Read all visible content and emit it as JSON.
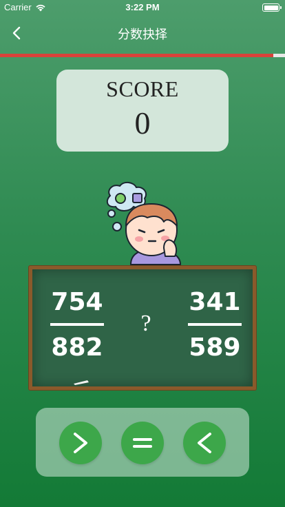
{
  "status_bar": {
    "carrier": "Carrier",
    "time": "3:22 PM"
  },
  "nav": {
    "title": "分数抉择",
    "back_icon": "chevron-left-icon"
  },
  "progress": {
    "fraction": 0.96,
    "fill_color": "#d9423a"
  },
  "score": {
    "label": "SCORE",
    "value": "0"
  },
  "question": {
    "left_numerator": "754",
    "left_denominator": "882",
    "operator_placeholder": "?",
    "right_numerator": "341",
    "right_denominator": "589"
  },
  "answers": [
    {
      "symbol": "greater-than",
      "icon": "greater-than-icon"
    },
    {
      "symbol": "equals",
      "icon": "equals-icon"
    },
    {
      "symbol": "less-than",
      "icon": "less-than-icon"
    }
  ],
  "colors": {
    "background_top": "#4d9d6c",
    "background_bottom": "#137a36",
    "button_green": "#3da74a",
    "chalkboard": "#2f6447",
    "board_frame": "#8a5a2b"
  }
}
